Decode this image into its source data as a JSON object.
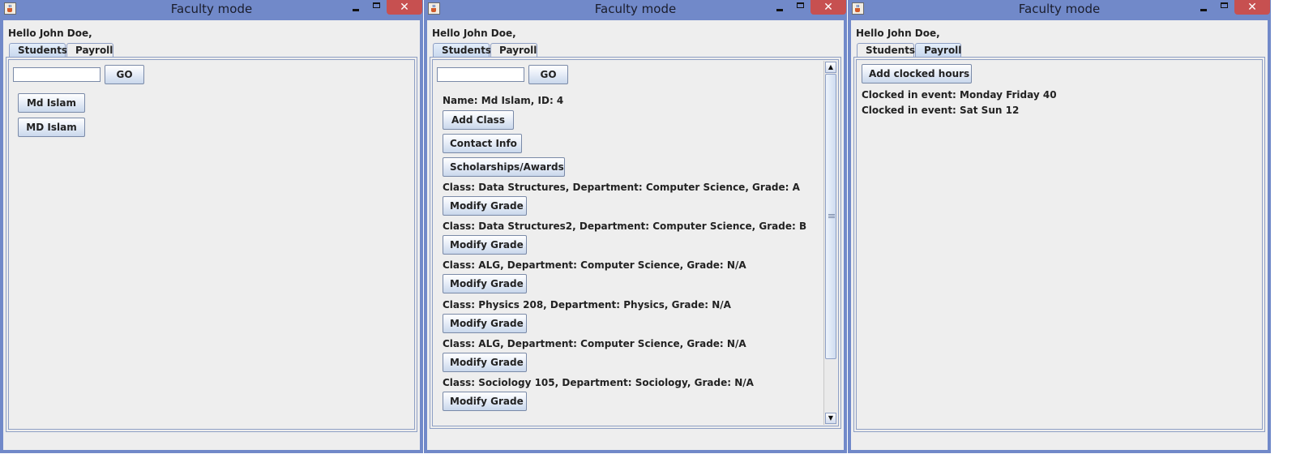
{
  "windows": [
    {
      "title": "Faculty mode",
      "greeting": "Hello John Doe,",
      "tabs": [
        "Students",
        "Payroll"
      ],
      "selected_tab": "Students",
      "search": {
        "value": "",
        "go_label": "GO"
      },
      "results": [
        "Md Islam",
        "MD Islam"
      ]
    },
    {
      "title": "Faculty mode",
      "greeting": "Hello John Doe,",
      "tabs": [
        "Students",
        "Payroll"
      ],
      "selected_tab": "Students",
      "search": {
        "value": "",
        "go_label": "GO"
      },
      "student_header": "Name: Md Islam, ID: 4",
      "actions": [
        "Add Class",
        "Contact Info",
        "Scholarships/Awards"
      ],
      "classes": [
        "Class:  Data Structures, Department:  Computer Science, Grade:  A",
        "Class:  Data Structures2, Department:  Computer Science, Grade:  B",
        "Class:  ALG, Department:  Computer Science, Grade:  N/A",
        "Class: Physics 208, Department:  Physics, Grade:  N/A",
        "Class: ALG, Department:  Computer Science, Grade:  N/A",
        "Class: Sociology 105, Department:  Sociology, Grade:  N/A"
      ],
      "modify_label": "Modify Grade"
    },
    {
      "title": "Faculty mode",
      "greeting": "Hello John Doe,",
      "tabs": [
        "Students",
        "Payroll"
      ],
      "selected_tab": "Payroll",
      "add_hours_label": "Add clocked hours",
      "clock_events": [
        "Clocked in event: Monday Friday 40",
        "Clocked in event: Sat Sun 12"
      ]
    }
  ],
  "colors": {
    "titlebar": "#7189c9",
    "close_button": "#c75050",
    "panel_bg": "#eeeeee",
    "border": "#8e9fc4"
  },
  "icons": {
    "app": "java-cup-icon",
    "minimize": "minimize-icon",
    "maximize": "maximize-icon",
    "close": "close-icon"
  }
}
